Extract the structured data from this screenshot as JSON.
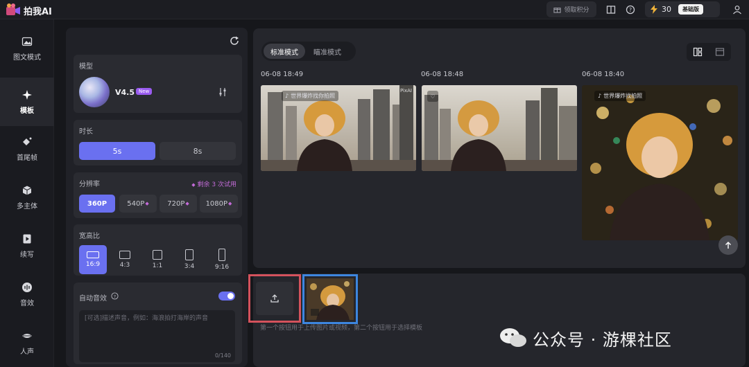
{
  "app": {
    "brand": "拍我AI"
  },
  "topbar": {
    "coupon_label": "领取积分",
    "credits": "30",
    "plan_label": "基础版"
  },
  "nav": [
    {
      "label": "图文模式",
      "icon": "image-icon"
    },
    {
      "label": "模板",
      "icon": "sparkle-icon",
      "active": true
    },
    {
      "label": "首尾帧",
      "icon": "frames-icon"
    },
    {
      "label": "多主体",
      "icon": "cube-icon"
    },
    {
      "label": "续写",
      "icon": "continue-icon"
    },
    {
      "label": "音效",
      "icon": "sound-icon"
    },
    {
      "label": "人声",
      "icon": "lips-icon"
    }
  ],
  "settings": {
    "model": {
      "title": "模型",
      "name": "V4.5",
      "badge": "New"
    },
    "duration": {
      "title": "时长",
      "options": [
        "5s",
        "8s"
      ],
      "selected": "5s"
    },
    "resolution": {
      "title": "分辨率",
      "note": "剩余 3 次试用",
      "options": [
        "360P",
        "540P",
        "720P",
        "1080P"
      ],
      "selected": "360P"
    },
    "ratio": {
      "title": "宽高比",
      "options": [
        "16:9",
        "4:3",
        "1:1",
        "3:4",
        "9:16"
      ],
      "selected": "16:9"
    },
    "audio": {
      "title": "自动音效",
      "enabled": true,
      "placeholder": "[可选]描述声音，例如：海浪拍打海岸的声音",
      "counter": "0/140"
    }
  },
  "results": {
    "tabs": [
      "标准模式",
      "瞄准模式"
    ],
    "active_tab": "标准模式",
    "items": [
      {
        "time": "06-08 18:49",
        "label": "世界爆炸找你拍照",
        "corner": "PixAI"
      },
      {
        "time": "06-08 18:48",
        "label": ""
      },
      {
        "time": "06-08 18:40",
        "label": "世界爆炸找拍照"
      }
    ]
  },
  "bottom": {
    "hint": "第一个按钮用于上传图片或视频，第二个按钮用于选择模板"
  },
  "watermark": {
    "text": "公众号 · 游棵社区"
  },
  "colors": {
    "accent": "#6a70f0",
    "upload_border": "#d4525c",
    "template_border": "#3d86e0",
    "gem": "#c36bd8"
  }
}
